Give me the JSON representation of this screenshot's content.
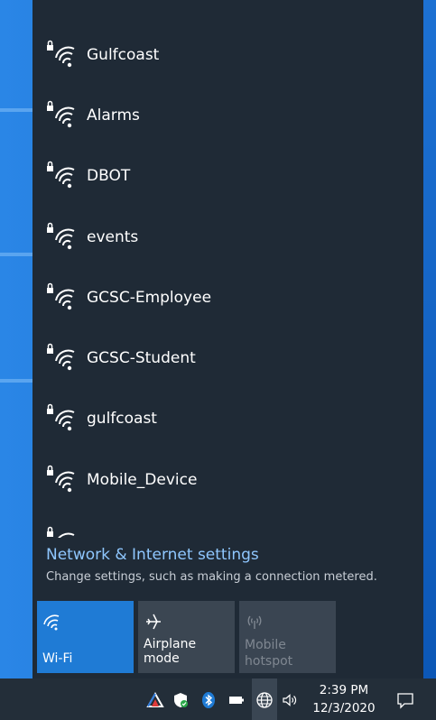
{
  "networks": [
    {
      "name": "Gulfcoast"
    },
    {
      "name": "Alarms"
    },
    {
      "name": "DBOT"
    },
    {
      "name": "events"
    },
    {
      "name": "GCSC-Employee"
    },
    {
      "name": "GCSC-Student"
    },
    {
      "name": "gulfcoast"
    },
    {
      "name": "Mobile_Device"
    }
  ],
  "settings": {
    "link_label": "Network & Internet settings",
    "description": "Change settings, such as making a connection metered."
  },
  "quick_actions": {
    "wifi": {
      "label": "Wi-Fi",
      "state": "on"
    },
    "airplane": {
      "label": "Airplane mode",
      "state": "off"
    },
    "hotspot": {
      "label_line1": "Mobile",
      "label_line2": "hotspot",
      "state": "disabled"
    }
  },
  "taskbar": {
    "time": "2:39 PM",
    "date": "12/3/2020",
    "tray_icons": [
      "vpn-icon",
      "defender-shield-icon",
      "bluetooth-icon",
      "battery-icon",
      "network-globe-icon",
      "volume-icon",
      "notifications-icon"
    ]
  },
  "colors": {
    "flyout_bg": "#1f2a36",
    "accent": "#1f7bd5",
    "link": "#8fc7ff"
  }
}
